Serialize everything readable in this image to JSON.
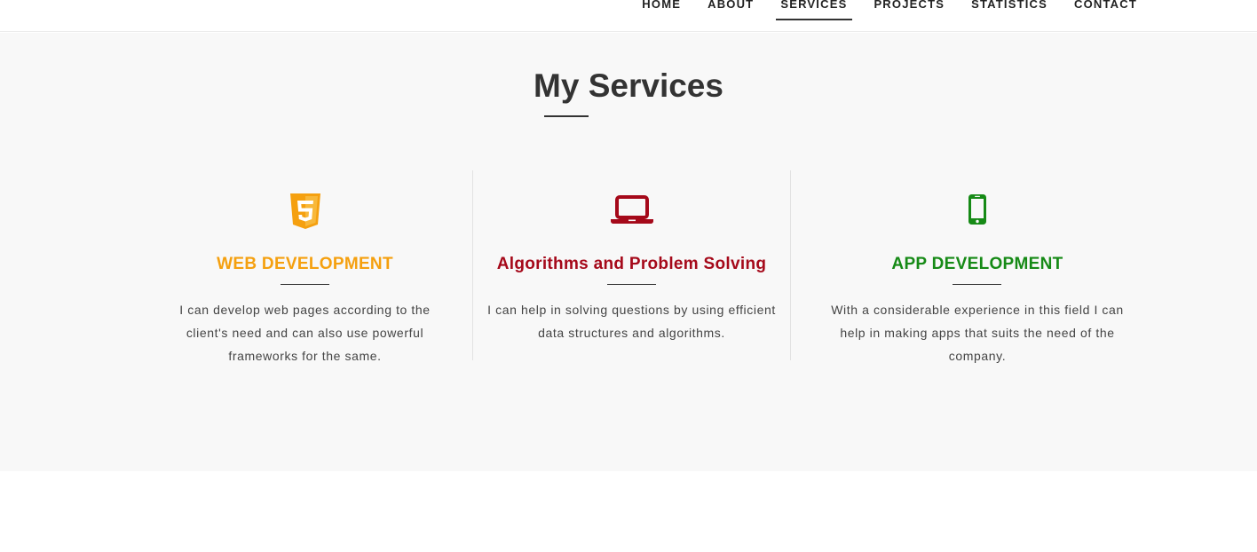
{
  "nav": {
    "items": [
      {
        "label": "HOME"
      },
      {
        "label": "ABOUT"
      },
      {
        "label": "SERVICES",
        "active": true
      },
      {
        "label": "PROJECTS"
      },
      {
        "label": "STATISTICS"
      },
      {
        "label": "CONTACT"
      }
    ]
  },
  "services_section": {
    "title": "My Services",
    "background": "#f8f8f8",
    "cards": [
      {
        "icon": "html5-icon",
        "color": "#f5a00f",
        "title": "WEB DEVELOPMENT",
        "description": "I can develop web pages according to the client's need and can also use powerful frameworks for the same."
      },
      {
        "icon": "laptop-icon",
        "color": "#a5091a",
        "title": "Algorithms and Problem Solving",
        "description": "I can help in solving questions by using efficient data structures and algorithms."
      },
      {
        "icon": "mobile-phone-icon",
        "color": "#168a16",
        "title": "APP DEVELOPMENT",
        "description": "With a considerable experience in this field I can help in making apps that suits the need of the company."
      }
    ]
  }
}
